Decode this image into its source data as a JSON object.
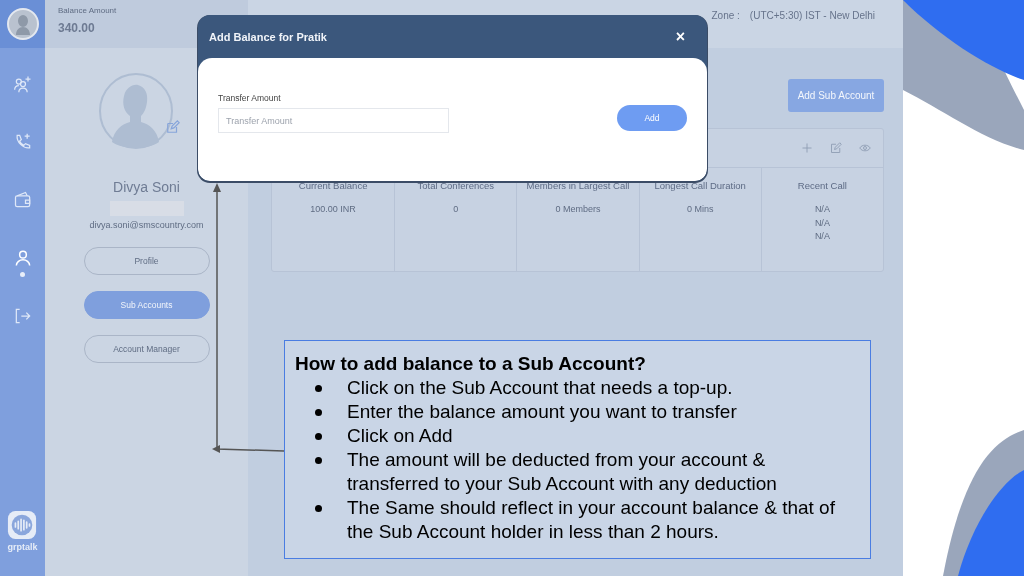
{
  "header": {
    "balance_label": "Balance Amount",
    "balance": "340.00",
    "timezone_label": "Zone :",
    "timezone": "(UTC+5:30) IST - New Delhi"
  },
  "rail": {
    "items": [
      {
        "kind": "add-users",
        "selected": false
      },
      {
        "kind": "phone",
        "selected": false
      },
      {
        "kind": "wallet",
        "selected": false
      },
      {
        "kind": "user",
        "selected": true
      },
      {
        "kind": "logout",
        "selected": false
      }
    ],
    "logo": "grptalk"
  },
  "profile": {
    "name": "Divya Soni",
    "email": "divya.soni@smscountry.com",
    "menu": [
      {
        "label": "Profile",
        "selected": false
      },
      {
        "label": "Sub Accounts",
        "selected": true
      },
      {
        "label": "Account Manager",
        "selected": false
      }
    ]
  },
  "add_sub_account": "Add Sub Account",
  "card": {
    "columns": [
      {
        "label": "Current Balance",
        "values": [
          "100.00 INR"
        ]
      },
      {
        "label": "Total Conferences",
        "values": [
          "0"
        ]
      },
      {
        "label": "Members in Largest Call",
        "values": [
          "0 Members"
        ]
      },
      {
        "label": "Longest Call Duration",
        "values": [
          "0 Mins"
        ]
      },
      {
        "label": "Recent Call",
        "values": [
          "N/A",
          "N/A",
          "N/A"
        ]
      }
    ]
  },
  "modal": {
    "title": "Add Balance for Pratik",
    "close": "×",
    "field_label": "Transfer Amount",
    "placeholder": "Transfer Amount",
    "button": "Add"
  },
  "callout": {
    "title": "How to add balance to a Sub Account?",
    "bullets": [
      "Click on the Sub Account that needs a top-up.",
      "Enter the balance amount you want to transfer",
      "Click on Add",
      "The amount will be deducted from your account & transferred to your Sub Account with any deduction",
      "The Same should reflect in your account balance & that of the Sub Account holder in less than 2 hours."
    ]
  }
}
